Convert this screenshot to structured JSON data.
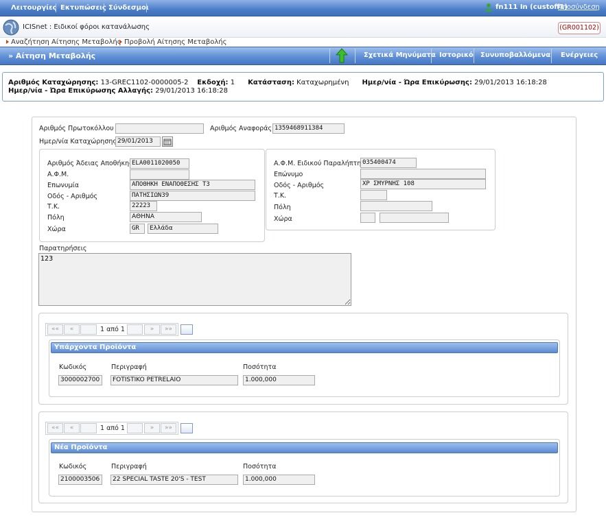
{
  "topbar": {
    "menu": [
      "Λειτουργίες",
      "Εκτυπώσεις",
      "Σύνδεσμοι"
    ],
    "user": "fn111 In (custoff1)",
    "logout": "Αποσύνδεση"
  },
  "app": {
    "title": "ICISnet : Ειδικοί φόροι κατανάλωσης",
    "code": "(GR001102)"
  },
  "breadcrumb": [
    "Αναζήτηση Αίτησης Μεταβολής",
    "Προβολή Αίτησης Μεταβολής"
  ],
  "titlebar": {
    "title": "» Αίτηση Μεταβολής",
    "buttons": [
      "Σχετικά Μηνύματα",
      "Ιστορικό",
      "Συνυποβαλλόμενα",
      "Ενέργειες"
    ]
  },
  "info": {
    "reg_no_label": "Αριθμός Καταχώρησης:",
    "reg_no": "13-GREC1102-0000005-2",
    "version_label": "Εκδοχή:",
    "version": "1",
    "status_label": "Κατάσταση:",
    "status": "Καταχωρημένη",
    "confirm_label": "Ημερ/νία - Ώρα Επικύρωσης:",
    "confirm": "29/01/2013 16:18:28",
    "change_confirm_label": "Ημερ/νία - Ώρα Επικύρωσης Αλλαγής:",
    "change_confirm": "29/01/2013 16:18:28"
  },
  "form": {
    "protocol_label": "Αριθμός Πρωτοκόλλου",
    "protocol": "",
    "reference_label": "Αριθμός Αναφοράς",
    "reference": "1359468911384",
    "reg_date_label": "Ημερ/νία Καταχώρησης",
    "reg_date": "29/01/2013",
    "sender": {
      "license_label": "Αριθμός Άδειας Αποθήκης",
      "license": "ELA0011020050",
      "afm_label": "Α.Φ.Μ.",
      "afm": "",
      "name_label": "Επωνυμία",
      "name": "ΑΠΟΘΗΚΗ ΕΝΑΠΟΘΕΣΗΣ Τ3",
      "street_label": "Οδός - Αριθμός",
      "street": "ΠΑΤΗΣΙΩΝ39",
      "zip_label": "Τ.Κ.",
      "zip": "22223",
      "city_label": "Πόλη",
      "city": "ΑΘΗΝΑ",
      "country_label": "Χώρα",
      "country_code": "GR",
      "country": "Ελλάδα"
    },
    "receiver": {
      "afm_label": "Α.Φ.Μ. Ειδικού Παραλήπτη",
      "afm": "035400474",
      "surname_label": "Επώνυμο",
      "surname": "",
      "street_label": "Οδός - Αριθμός",
      "street": "ΧΡ ΣΜΥΡΝΗΣ 108",
      "zip_label": "Τ.Κ.",
      "zip": "",
      "city_label": "Πόλη",
      "city": "",
      "country_label": "Χώρα",
      "country_code": "",
      "country": ""
    },
    "remarks_label": "Παρατηρήσεις",
    "remarks": "123"
  },
  "existing": {
    "pager": {
      "first": "««",
      "prev": "«",
      "text": "1 από 1",
      "next": "»",
      "last": "»»"
    },
    "title": "Υπάρχοντα Προϊόντα",
    "code_label": "Κωδικός",
    "desc_label": "Περιγραφή",
    "qty_label": "Ποσότητα",
    "code": "3000002700",
    "desc": "FOTISTIKO PETRELAIO",
    "qty": "1.000,000"
  },
  "new": {
    "pager": {
      "first": "««",
      "prev": "«",
      "text": "1 από 1",
      "next": "»",
      "last": "»»"
    },
    "title": "Νέα Προϊόντα",
    "code_label": "Κωδικός",
    "desc_label": "Περιγραφή",
    "qty_label": "Ποσότητα",
    "code": "2100003506",
    "desc": "22 SPECIAL TASTE 20'S - TEST",
    "qty": "1.000,000"
  },
  "colors": {
    "menu_blue": "#4c7fc9",
    "code_red": "#aa0000",
    "breadcrumb_arrow": "#d04010"
  }
}
